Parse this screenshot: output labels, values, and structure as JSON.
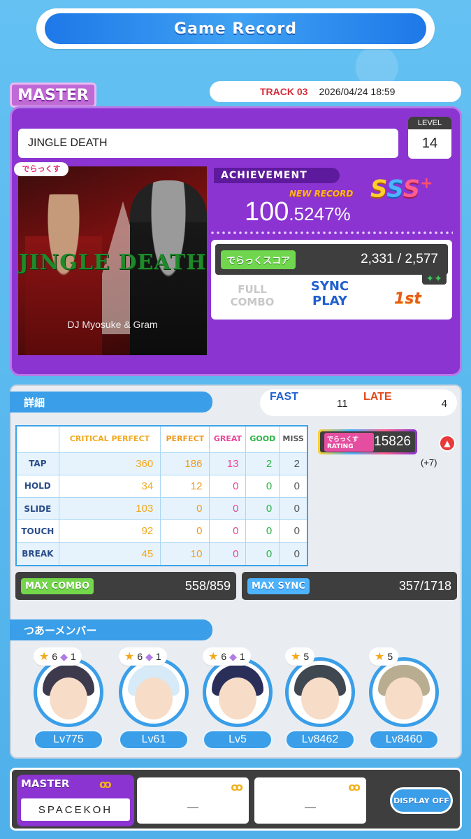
{
  "header": {
    "title": "Game Record"
  },
  "difficulty": "MASTER",
  "track": {
    "number": "TRACK 03",
    "datetime": "2026/04/24 18:59"
  },
  "song": {
    "title": "JINGLE DEATH",
    "level_label": "LEVEL",
    "level": "14",
    "jacket_title": "JINGLE DEATH",
    "jacket_artist": "DJ Myosuke & Gram",
    "jacket_badge": "でらっくす"
  },
  "result": {
    "achievement_label": "ACHIEVEMENT",
    "new_record_label": "NEW RECORD",
    "achievement_int": "100",
    "achievement_dec": ".5247%",
    "rank": [
      "S",
      "S",
      "S"
    ],
    "rank_plus": "+",
    "dx_score_label": "でらっくスコア",
    "dx_score": "2,331 / 2,577",
    "dx_stars": "✦✦",
    "fc_badge": "FULL COMBO",
    "sync_play": "SYNC PLAY",
    "place": "1st"
  },
  "details": {
    "section_label": "詳細",
    "fast_label": "FAST",
    "fast": "11",
    "late_label": "LATE",
    "late": "4",
    "columns": [
      "",
      "CRITICAL PERFECT",
      "PERFECT",
      "GREAT",
      "GOOD",
      "MISS"
    ],
    "rows": [
      {
        "label": "TAP",
        "values": [
          "360",
          "186",
          "13",
          "2",
          "2"
        ]
      },
      {
        "label": "HOLD",
        "values": [
          "34",
          "12",
          "0",
          "0",
          "0"
        ]
      },
      {
        "label": "SLIDE",
        "values": [
          "103",
          "0",
          "0",
          "0",
          "0"
        ]
      },
      {
        "label": "TOUCH",
        "values": [
          "92",
          "0",
          "0",
          "0",
          "0"
        ]
      },
      {
        "label": "BREAK",
        "values": [
          "45",
          "10",
          "0",
          "0",
          "0"
        ]
      }
    ],
    "rating_logo": "でらっくす RATING",
    "rating": "15826",
    "rating_up_icon": "▲",
    "rating_delta": "(+7)",
    "max_combo_label": "MAX COMBO",
    "max_combo": "558/859",
    "max_sync_label": "MAX SYNC",
    "max_sync": "357/1718"
  },
  "tour": {
    "section_label": "つあーメンバー",
    "members": [
      {
        "stars": "6",
        "gems": "1",
        "level": "Lv775",
        "hair": "#3d3a4e"
      },
      {
        "stars": "6",
        "gems": "1",
        "level": "Lv61",
        "hair": "#d6eaf7"
      },
      {
        "stars": "6",
        "gems": "1",
        "level": "Lv5",
        "hair": "#2a2f5a"
      },
      {
        "stars": "5",
        "gems": "",
        "level": "Lv8462",
        "hair": "#3f4750"
      },
      {
        "stars": "5",
        "gems": "",
        "level": "Lv8460",
        "hair": "#b8ad90"
      }
    ]
  },
  "player": {
    "difficulty": "MASTER",
    "name": "SPACEKOH",
    "glasses": "ꝏ",
    "slot2": "—",
    "slot3": "—",
    "display_button": "DISPLAY OFF"
  }
}
